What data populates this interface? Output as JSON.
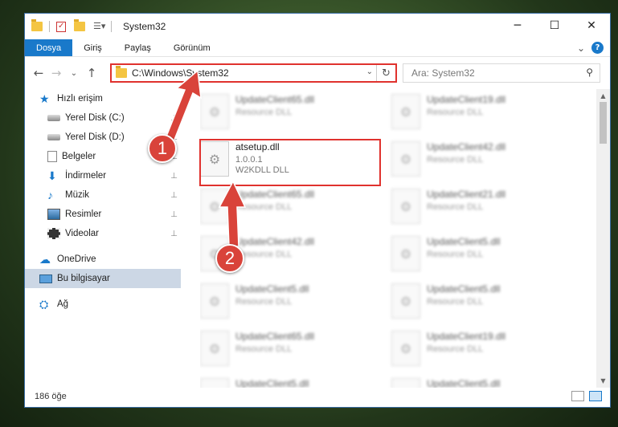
{
  "window": {
    "title": "System32",
    "minimize": "─",
    "maximize": "☐",
    "close": "✕"
  },
  "ribbon": {
    "tabs": [
      "Dosya",
      "Giriş",
      "Paylaş",
      "Görünüm"
    ],
    "expand": "⌄",
    "help": "?"
  },
  "nav": {
    "back": "←",
    "forward": "→",
    "recent": "⌄",
    "up": "↑",
    "address": "C:\\Windows\\System32",
    "address_dropdown": "⌄",
    "refresh": "↻",
    "search_placeholder": "Ara: System32",
    "search_icon": "⚲"
  },
  "sidebar": {
    "items": [
      {
        "label": "Hızlı erişim",
        "icon": "star-icon"
      },
      {
        "label": "Yerel Disk (C:)",
        "icon": "disk-icon",
        "pinned": true
      },
      {
        "label": "Yerel Disk (D:)",
        "icon": "disk-icon",
        "pinned": true
      },
      {
        "label": "Belgeler",
        "icon": "document-icon",
        "pinned": true
      },
      {
        "label": "İndirmeler",
        "icon": "download-icon",
        "pinned": true
      },
      {
        "label": "Müzik",
        "icon": "music-icon",
        "pinned": true
      },
      {
        "label": "Resimler",
        "icon": "pictures-icon",
        "pinned": true
      },
      {
        "label": "Videolar",
        "icon": "videos-icon",
        "pinned": true
      },
      {
        "label": "OneDrive",
        "icon": "cloud-icon"
      },
      {
        "label": "Bu bilgisayar",
        "icon": "computer-icon",
        "selected": true
      },
      {
        "label": "Ağ",
        "icon": "network-icon"
      }
    ],
    "pin_glyph": "📌"
  },
  "files": {
    "left": [
      {
        "name": "UpdateClient65.dll",
        "type": "Resource DLL"
      },
      {
        "name": "atsetup.dll",
        "version": "1.0.0.1",
        "desc": "W2KDLL DLL",
        "highlighted": true
      },
      {
        "name": "UpdateClient65.dll",
        "type": "Resource DLL"
      },
      {
        "name": "UpdateClient42.dll",
        "type": "Resource DLL"
      },
      {
        "name": "UpdateClient5.dll",
        "type": "Resource DLL"
      },
      {
        "name": "UpdateClient65.dll",
        "type": "Resource DLL"
      },
      {
        "name": "UpdateClient5.dll",
        "type": "Resource DLL"
      }
    ],
    "right": [
      {
        "name": "UpdateClient19.dll",
        "type": "Resource DLL"
      },
      {
        "name": "UpdateClient42.dll",
        "type": "Resource DLL"
      },
      {
        "name": "UpdateClient21.dll",
        "type": "Resource DLL"
      },
      {
        "name": "UpdateClient5.dll",
        "type": "Resource DLL"
      },
      {
        "name": "UpdateClient5.dll",
        "type": "Resource DLL"
      },
      {
        "name": "UpdateClient19.dll",
        "type": "Resource DLL"
      },
      {
        "name": "UpdateClient5.dll",
        "type": "Resource DLL"
      }
    ]
  },
  "status": {
    "count": "186 öğe"
  },
  "markers": {
    "one": "1",
    "two": "2"
  },
  "colors": {
    "accent": "#1979ca",
    "highlight": "#e0322e",
    "marker": "#d9433a"
  }
}
